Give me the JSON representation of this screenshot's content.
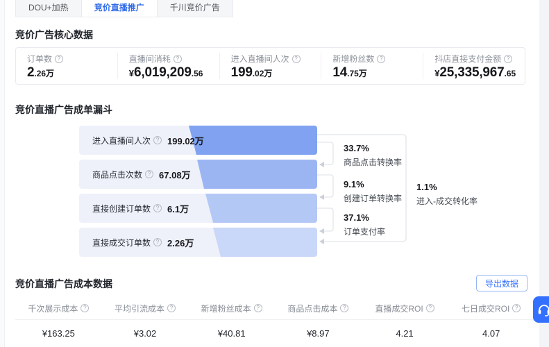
{
  "colors": {
    "accent": "#3370ff",
    "funnel_row_bg": "#eef1fa",
    "funnel_levels": [
      "#80a2f0",
      "#9bb5f3",
      "#b4c8f6",
      "#c9d7f8"
    ]
  },
  "icons": {
    "info": "?"
  },
  "tabs": {
    "items": [
      {
        "label": "DOU+加热",
        "active": false
      },
      {
        "label": "竞价直播推广",
        "active": true
      },
      {
        "label": "千川竞价广告",
        "active": false
      }
    ]
  },
  "core": {
    "title": "竞价广告核心数据",
    "metrics": [
      {
        "label": "订单数",
        "prefix": "",
        "int": "2",
        "dec": ".26万"
      },
      {
        "label": "直播间消耗",
        "prefix": "¥",
        "int": "6,019,209",
        "dec": ".56"
      },
      {
        "label": "进入直播间人次",
        "prefix": "",
        "int": "199",
        "dec": ".02万"
      },
      {
        "label": "新增粉丝数",
        "prefix": "",
        "int": "14",
        "dec": ".75万"
      },
      {
        "label": "抖店直接支付金额",
        "prefix": "¥",
        "int": "25,335,967",
        "dec": ".65"
      }
    ]
  },
  "funnel": {
    "title": "竞价直播广告成单漏斗",
    "rows": [
      {
        "label": "进入直播间人次",
        "value": "199.02万",
        "color": "#80a2f0"
      },
      {
        "label": "商品点击次数",
        "value": "67.08万",
        "color": "#9bb5f3"
      },
      {
        "label": "直接创建订单数",
        "value": "6.1万",
        "color": "#b4c8f6"
      },
      {
        "label": "直接成交订单数",
        "value": "2.26万",
        "color": "#c9d7f8"
      }
    ],
    "rates": [
      {
        "value": "33.7%",
        "label": "商品点击转换率"
      },
      {
        "value": "9.1%",
        "label": "创建订单转换率"
      },
      {
        "value": "37.1%",
        "label": "订单支付率"
      }
    ],
    "overall": {
      "value": "1.1%",
      "label": "进入-成交转化率"
    }
  },
  "cost": {
    "title": "竞价直播广告成本数据",
    "export_label": "导出数据",
    "columns": [
      "千次展示成本",
      "平均引流成本",
      "新增粉丝成本",
      "商品点击成本",
      "直播成交ROI",
      "七日成交ROI"
    ],
    "values": [
      "¥163.25",
      "¥3.02",
      "¥40.81",
      "¥8.97",
      "4.21",
      "4.07"
    ]
  }
}
